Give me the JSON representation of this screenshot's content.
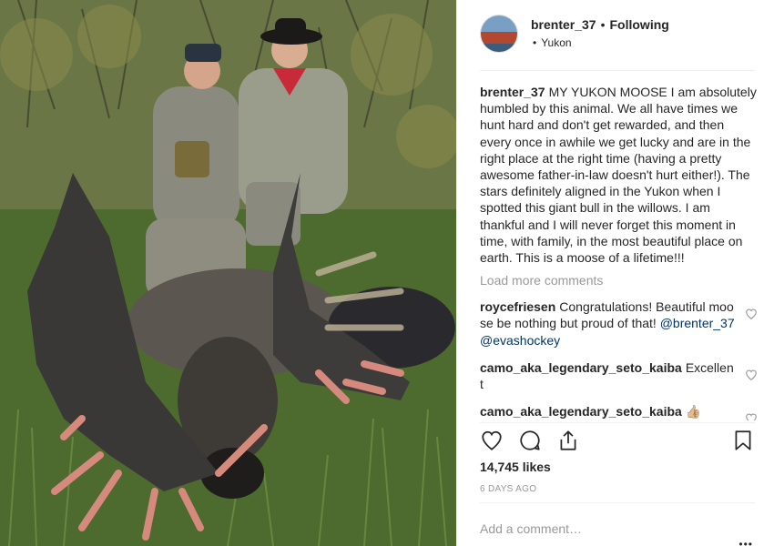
{
  "post": {
    "username": "brenter_37",
    "separator": "•",
    "follow_status": "Following",
    "location": "Yukon",
    "caption": "I am absolutely humbled by this animal. We all have times we hunt hard and don't get rewarded, and then every once in awhile we get lucky and are in the right place at the right time (having a pretty awesome father-in-law doesn't hurt either!). The stars definitely aligned in the Yukon when I spotted this giant bull in the willows. I am thankful and I will never forget this moment in time, with family, in the most beautiful place on earth. This is a moose of a lifetime!!!",
    "caption_title": "MY YUKON MOOSE",
    "load_more": "Load more comments",
    "likes": "14,745 likes",
    "timestamp": "6 DAYS AGO",
    "comment_placeholder": "Add a comment…",
    "more": "•••"
  },
  "comments": [
    {
      "username": "roycefriesen",
      "text": "Congratulations! Beautiful moose be nothing but proud of that!",
      "mentions": "@brenter_37 @evashockey"
    },
    {
      "username": "camo_aka_legendary_seto_kaiba",
      "text": "Excellent"
    },
    {
      "username": "camo_aka_legendary_seto_kaiba",
      "text": "👍🏼"
    }
  ],
  "icons": {
    "like": "heart-icon",
    "comment": "comment-bubble-icon",
    "share": "share-upload-icon",
    "save": "bookmark-icon",
    "comment_like": "heart-small-icon"
  },
  "colors": {
    "text": "#262626",
    "muted": "#999999",
    "mention": "#003569",
    "divider": "#efefef"
  }
}
